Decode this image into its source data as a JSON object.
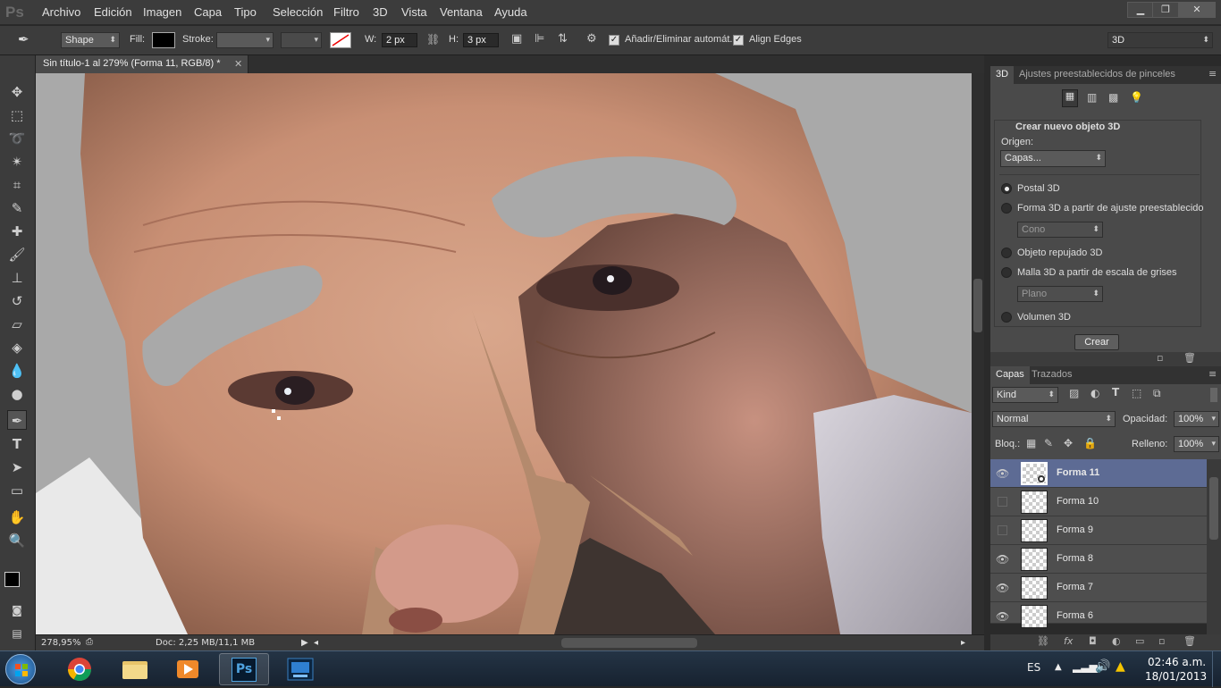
{
  "app": {
    "logo": "Ps"
  },
  "menu": [
    "Archivo",
    "Edición",
    "Imagen",
    "Capa",
    "Tipo",
    "Selección",
    "Filtro",
    "3D",
    "Vista",
    "Ventana",
    "Ayuda"
  ],
  "window_controls": {
    "minimize": "▁",
    "restore": "❐",
    "close": "✕"
  },
  "options": {
    "mode": "Shape",
    "fill_label": "Fill:",
    "stroke_label": "Stroke:",
    "width_label": "W:",
    "width_value": "2 px",
    "height_label": "H:",
    "height_value": "3 px",
    "auto_add_delete": "Añadir/Eliminar automát.",
    "align_edges": "Align Edges",
    "workspace": "3D"
  },
  "document": {
    "tab_title": "Sin título-1 al 279% (Forma 11, RGB/8) *",
    "tab_close": "✕"
  },
  "status": {
    "zoom": "278,95%",
    "doc": "Doc: 2,25 MB/11,1 MB"
  },
  "panel3d": {
    "tabs": [
      "3D",
      "Ajustes preestablecidos de pinceles"
    ],
    "section_title": "Crear nuevo objeto 3D",
    "source_label": "Origen:",
    "source_value": "Capas...",
    "options": [
      "Postal 3D",
      "Forma 3D a partir de ajuste preestablecido",
      "Objeto repujado 3D",
      "Malla 3D a partir de escala de grises",
      "Volumen 3D"
    ],
    "preset_value": "Cono",
    "grayscale_value": "Plano",
    "create_button": "Crear"
  },
  "layers_panel": {
    "tabs": [
      "Capas",
      "Trazados"
    ],
    "kind": "Kind",
    "blend": "Normal",
    "opacity_label": "Opacidad:",
    "opacity_value": "100%",
    "lock_label": "Bloq.:",
    "fill_label": "Relleno:",
    "fill_value": "100%",
    "layers": [
      {
        "name": "Forma 11",
        "visible": true,
        "selected": true
      },
      {
        "name": "Forma 10",
        "visible": false,
        "selected": false
      },
      {
        "name": "Forma 9",
        "visible": false,
        "selected": false
      },
      {
        "name": "Forma 8",
        "visible": true,
        "selected": false
      },
      {
        "name": "Forma 7",
        "visible": true,
        "selected": false
      },
      {
        "name": "Forma 6",
        "visible": true,
        "selected": false
      }
    ]
  },
  "taskbar": {
    "language": "ES",
    "time": "02:46 a.m.",
    "date": "18/01/2013",
    "ps_label": "Ps"
  }
}
